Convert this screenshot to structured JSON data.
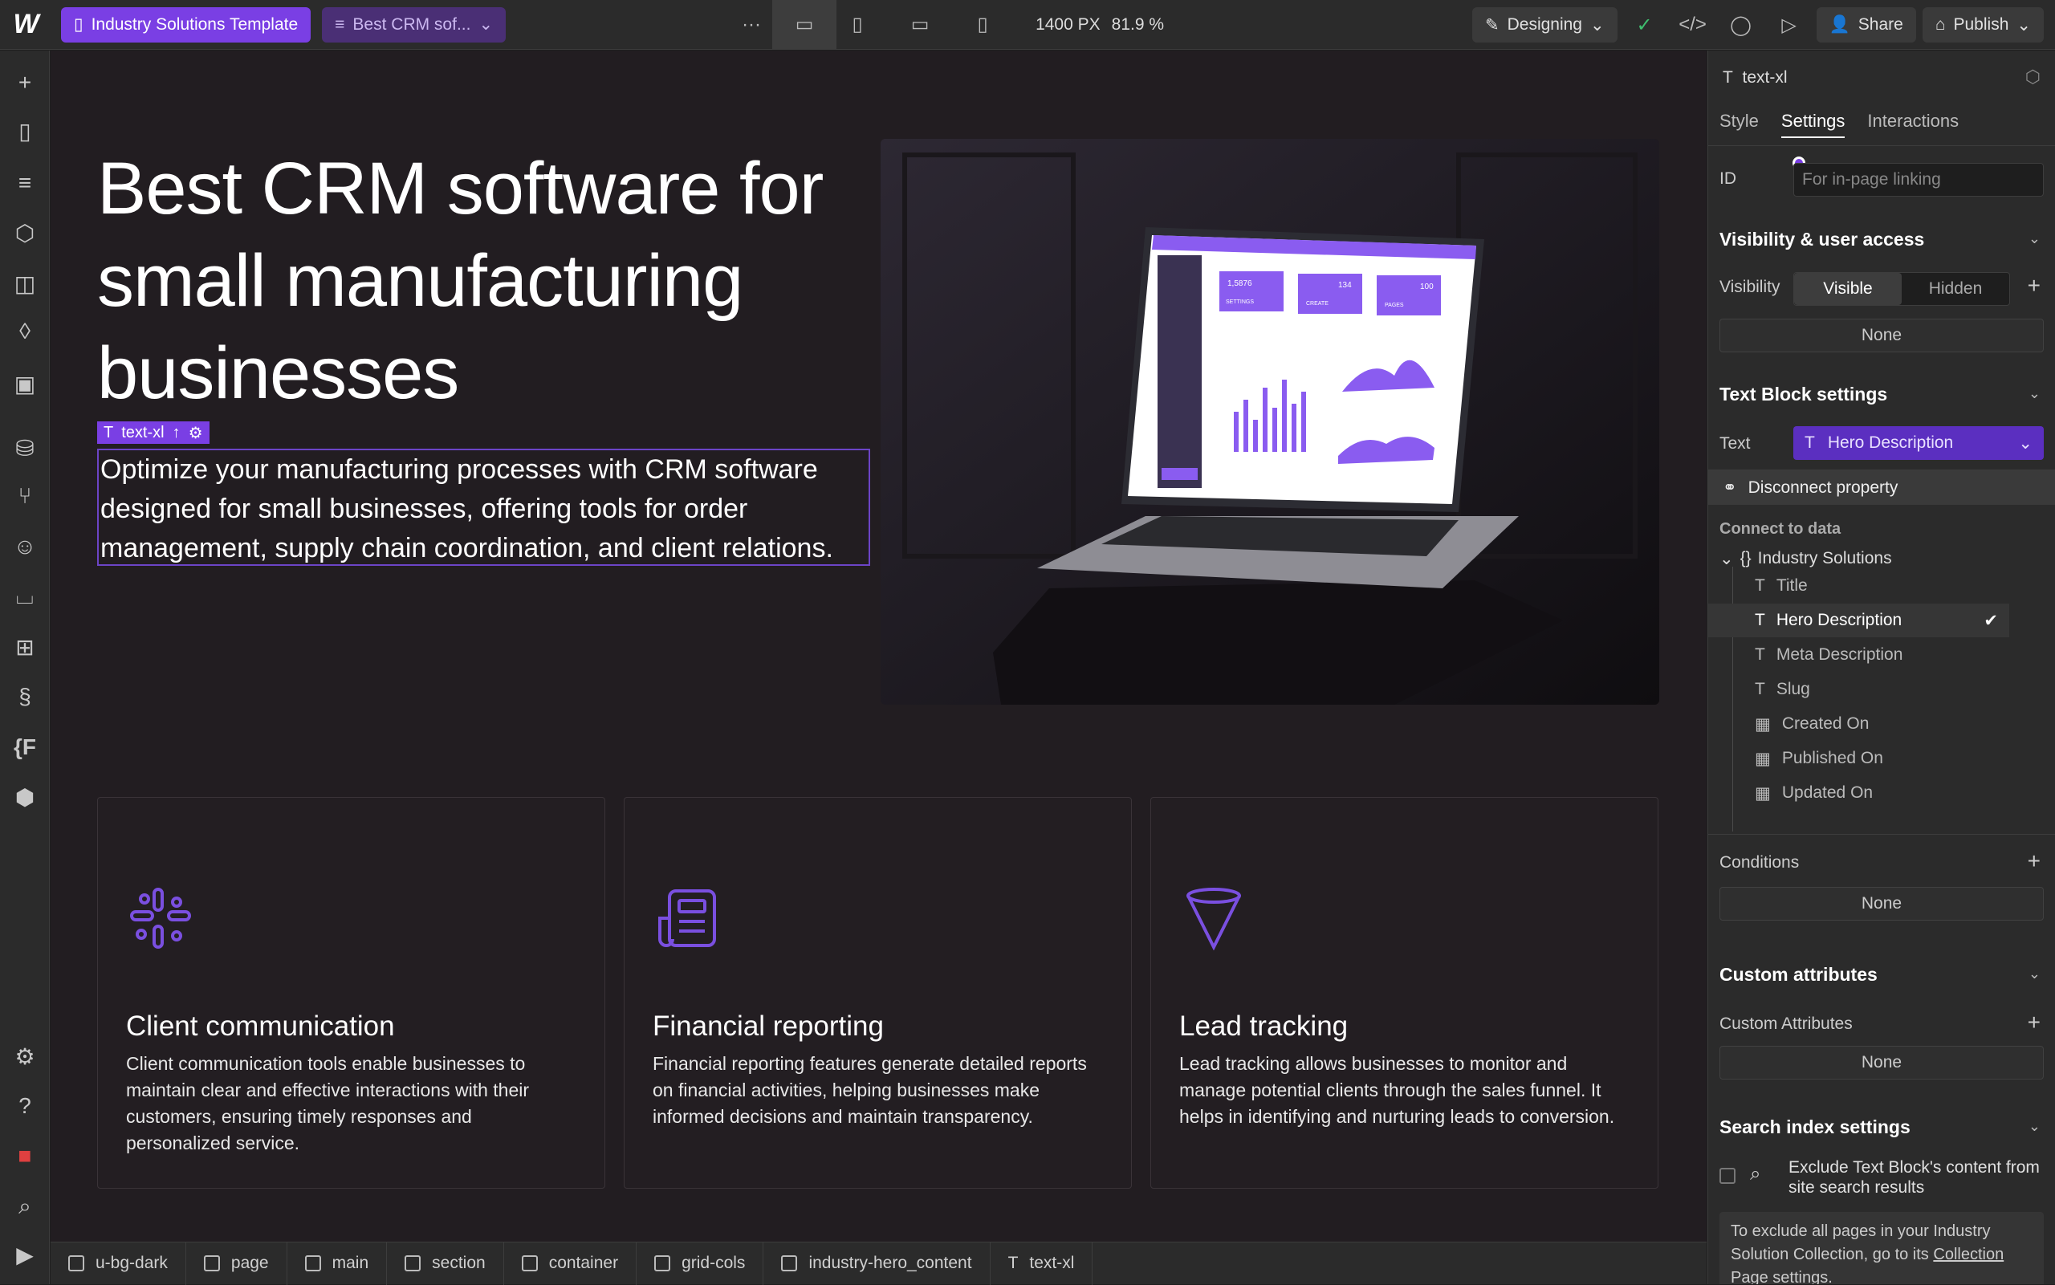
{
  "topbar": {
    "project_name": "Industry Solutions Template",
    "page_name": "Best CRM sof...",
    "more_label": "···",
    "width_label": "1400 PX",
    "zoom_label": "81.9 %",
    "mode_label": "Designing",
    "share_label": "Share",
    "publish_label": "Publish"
  },
  "hero": {
    "title": "Best CRM software for small manufacturing businesses",
    "selected_label": "text-xl",
    "description": "Optimize your manufacturing processes with CRM software designed for small businesses, offering tools for order management, supply chain coordination, and client relations."
  },
  "cards": [
    {
      "title": "Client communication",
      "text": "Client communication tools enable businesses to maintain clear and effective interactions with their customers, ensuring timely responses and personalized service.",
      "icon": "slack-like-icon"
    },
    {
      "title": "Financial reporting",
      "text": "Financial reporting features generate detailed reports on financial activities, helping businesses make informed decisions and maintain transparency.",
      "icon": "newspaper-icon"
    },
    {
      "title": "Lead tracking",
      "text": "Lead tracking allows businesses to monitor and manage potential clients through the sales funnel. It helps in identifying and nurturing leads to conversion.",
      "icon": "funnel-icon"
    }
  ],
  "breadcrumb": [
    "u-bg-dark",
    "page",
    "main",
    "section",
    "container",
    "grid-cols",
    "industry-hero_content",
    "text-xl"
  ],
  "panel": {
    "element_label": "text-xl",
    "tabs": [
      "Style",
      "Settings",
      "Interactions"
    ],
    "id_label": "ID",
    "id_placeholder": "For in-page linking",
    "visibility_section": "Visibility & user access",
    "visibility_label": "Visibility",
    "visible_label": "Visible",
    "hidden_label": "Hidden",
    "none_label": "None",
    "text_block_section": "Text Block settings",
    "text_label": "Text",
    "text_value": "Hero Description",
    "disconnect_label": "Disconnect property",
    "connect_label": "Connect to data",
    "collection_name": "Industry Solutions",
    "fields": [
      "Title",
      "Hero Description",
      "Meta Description",
      "Slug",
      "Created On",
      "Published On",
      "Updated On"
    ],
    "conditions_label": "Conditions",
    "custom_attr_section": "Custom attributes",
    "custom_attr_label": "Custom Attributes",
    "search_section": "Search index settings",
    "exclude_text": "Exclude Text Block's content from site search results",
    "info_text": "To exclude all pages in your Industry Solution Collection, go to its",
    "info_link": "Collection",
    "info_tail": "Page settings."
  },
  "mockup": {
    "stats": [
      "1,5876",
      "134",
      "100"
    ],
    "stat_labels": [
      "SETTINGS",
      "CREATE",
      "PAGES"
    ]
  },
  "colors": {
    "accent": "#7a3fe4",
    "canvas": "#221d21",
    "panel": "#2b2b2b"
  }
}
